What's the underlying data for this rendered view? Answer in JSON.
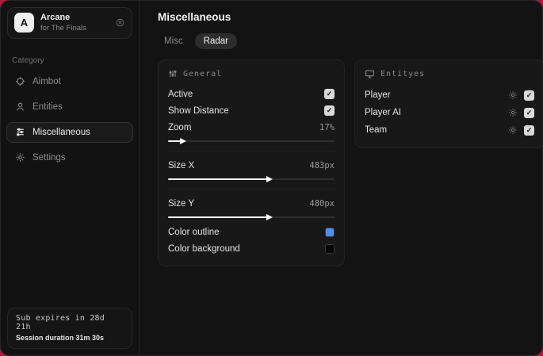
{
  "theme": {
    "backdrop": "#b3173f",
    "window_bg": "#131313",
    "panel_bg": "#181818",
    "accent_outline": "#4f8ee8",
    "background_swatch": "#000000"
  },
  "sidebar": {
    "brand": {
      "logo_letter": "A",
      "name": "Arcane",
      "subtitle": "for The Finals",
      "action_icon": "target-icon"
    },
    "category_label": "Category",
    "items": [
      {
        "label": "Aimbot",
        "icon": "crosshair-icon",
        "active": false
      },
      {
        "label": "Entities",
        "icon": "entities-icon",
        "active": false
      },
      {
        "label": "Miscellaneous",
        "icon": "sliders-icon",
        "active": true
      },
      {
        "label": "Settings",
        "icon": "gear-icon",
        "active": false
      }
    ],
    "footer": {
      "sub_expires": "Sub expires in 28d 21h",
      "session_duration": "Session duration 31m 30s"
    }
  },
  "main": {
    "title": "Miscellaneous",
    "tabs": [
      {
        "label": "Misc",
        "active": false
      },
      {
        "label": "Radar",
        "active": true
      }
    ],
    "general_panel": {
      "title": "General",
      "icon": "sliders-icon",
      "toggles": [
        {
          "label": "Active",
          "checked": true
        },
        {
          "label": "Show Distance",
          "checked": true
        }
      ],
      "sliders": [
        {
          "label": "Zoom",
          "value": "17%",
          "fill_percent": 8
        },
        {
          "label": "Size X",
          "value": "483px",
          "fill_percent": 60
        },
        {
          "label": "Size Y",
          "value": "480px",
          "fill_percent": 60
        }
      ],
      "colors": [
        {
          "label": "Color outline",
          "swatch": "#4f8ee8"
        },
        {
          "label": "Color background",
          "swatch": "#000000"
        }
      ]
    },
    "entities_panel": {
      "title": "Entityes",
      "icon": "monitor-icon",
      "rows": [
        {
          "label": "Player",
          "checked": true
        },
        {
          "label": "Player AI",
          "checked": true
        },
        {
          "label": "Team",
          "checked": true
        }
      ]
    }
  },
  "glyphs": {
    "check": "✓"
  }
}
